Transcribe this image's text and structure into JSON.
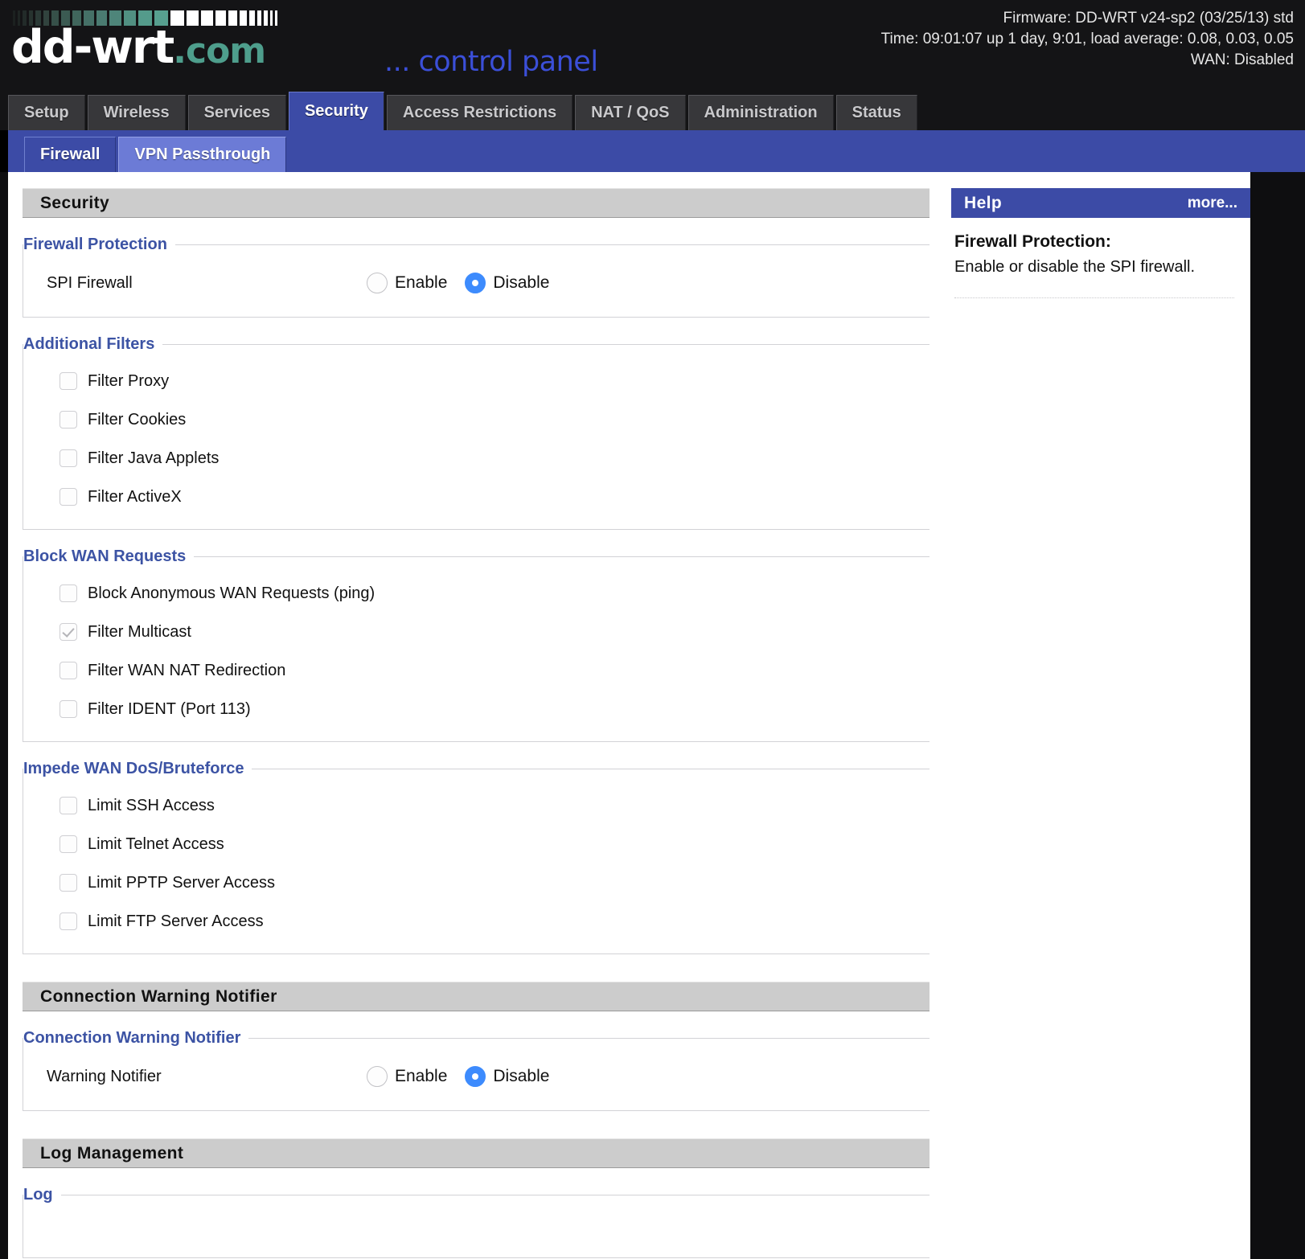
{
  "header": {
    "logo_main": "dd-wrt",
    "logo_suffix": ".com",
    "control_panel": "... control panel",
    "firmware": "Firmware: DD-WRT v24-sp2 (03/25/13) std",
    "time": "Time: 09:01:07 up 1 day, 9:01, load average: 0.08, 0.03, 0.05",
    "wan": "WAN: Disabled"
  },
  "colors": {
    "accent_blue": "#3c4ba6",
    "radio_on": "#3d8bfd",
    "legend_blue": "#3c53a4",
    "logo_green": "#4e9e8c",
    "sectionbar_gray": "#cccccc"
  },
  "nav": {
    "tabs": [
      {
        "label": "Setup",
        "active": false
      },
      {
        "label": "Wireless",
        "active": false
      },
      {
        "label": "Services",
        "active": false
      },
      {
        "label": "Security",
        "active": true
      },
      {
        "label": "Access Restrictions",
        "active": false
      },
      {
        "label": "NAT / QoS",
        "active": false
      },
      {
        "label": "Administration",
        "active": false
      },
      {
        "label": "Status",
        "active": false
      }
    ],
    "subtabs": [
      {
        "label": "Firewall",
        "active": true
      },
      {
        "label": "VPN Passthrough",
        "active": false
      }
    ]
  },
  "sections": {
    "security_bar": "Security",
    "firewall_protection": {
      "legend": "Firewall Protection",
      "row_label": "SPI Firewall",
      "enable_label": "Enable",
      "disable_label": "Disable",
      "selected": "Disable"
    },
    "additional_filters": {
      "legend": "Additional Filters",
      "items": [
        {
          "label": "Filter Proxy",
          "checked": false
        },
        {
          "label": "Filter Cookies",
          "checked": false
        },
        {
          "label": "Filter Java Applets",
          "checked": false
        },
        {
          "label": "Filter ActiveX",
          "checked": false
        }
      ]
    },
    "block_wan_requests": {
      "legend": "Block WAN Requests",
      "items": [
        {
          "label": "Block Anonymous WAN Requests (ping)",
          "checked": false
        },
        {
          "label": "Filter Multicast",
          "checked": true
        },
        {
          "label": "Filter WAN NAT Redirection",
          "checked": false
        },
        {
          "label": "Filter IDENT (Port 113)",
          "checked": false
        }
      ]
    },
    "impede_wan_dos": {
      "legend": "Impede WAN DoS/Bruteforce",
      "items": [
        {
          "label": "Limit SSH Access",
          "checked": false
        },
        {
          "label": "Limit Telnet Access",
          "checked": false
        },
        {
          "label": "Limit PPTP Server Access",
          "checked": false
        },
        {
          "label": "Limit FTP Server Access",
          "checked": false
        }
      ]
    },
    "connection_warning_bar": "Connection Warning Notifier",
    "connection_warning": {
      "legend": "Connection Warning Notifier",
      "row_label": "Warning Notifier",
      "enable_label": "Enable",
      "disable_label": "Disable",
      "selected": "Disable"
    },
    "log_management_bar": "Log Management",
    "log": {
      "legend": "Log"
    }
  },
  "help": {
    "title": "Help",
    "more": "more...",
    "heading": "Firewall Protection:",
    "text": "Enable or disable the SPI firewall."
  }
}
